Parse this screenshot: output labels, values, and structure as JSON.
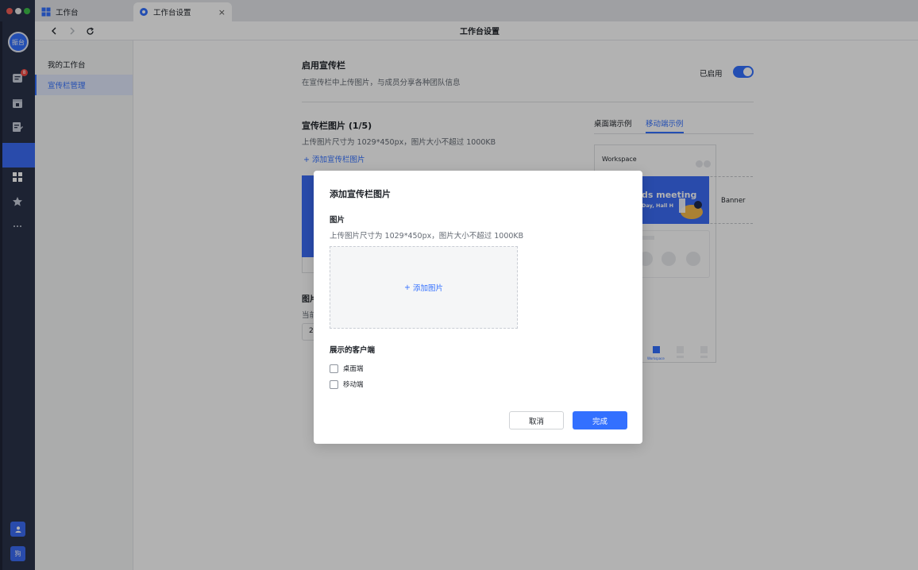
{
  "tabs": [
    {
      "label": "工作台",
      "icon": "grid-icon"
    },
    {
      "label": "工作台设置",
      "icon": "gear-icon",
      "close_glyph": "×"
    }
  ],
  "sidebar": {
    "avatar_text": "振台",
    "badge_count": "8",
    "bottom_user_text": "狗"
  },
  "nav": {
    "title": "工作台设置"
  },
  "menu": {
    "items": [
      {
        "label": "我的工作台"
      },
      {
        "label": "宣传栏管理"
      }
    ]
  },
  "main": {
    "enable_title": "启用宣传栏",
    "enable_desc": "在宣传栏中上传图片，与成员分享各种团队信息",
    "enabled_label": "已启用",
    "images_title": "宣传栏图片 (1/5)",
    "images_desc": "上传图片尺寸为 1029*450px，图片大小不超过 1000KB",
    "add_banner_link": "添加宣传栏图片",
    "partial_title": "图片",
    "partial_desc": "当前",
    "partial_input": "2",
    "preview_tabs": [
      "桌面端示例",
      "移动端示例"
    ],
    "phone_header": "Workspace",
    "phone_banner_title": "ds meeting",
    "phone_banner_sub": "Day, Hall H",
    "banner_label": "Banner",
    "phone_tab_label": "Workspace"
  },
  "modal": {
    "title": "添加宣传栏图片",
    "image_label": "图片",
    "image_desc": "上传图片尺寸为 1029*450px，图片大小不超过 1000KB",
    "upload_label": "添加图片",
    "clients_label": "展示的客户端",
    "options": [
      {
        "label": "桌面端",
        "checked": false
      },
      {
        "label": "移动端",
        "checked": false
      }
    ],
    "cancel_label": "取消",
    "done_label": "完成"
  },
  "colors": {
    "accent": "#3370ff",
    "sidebar_bg": "#2a334a",
    "overlay": "rgba(0,0,0,0.30)"
  }
}
